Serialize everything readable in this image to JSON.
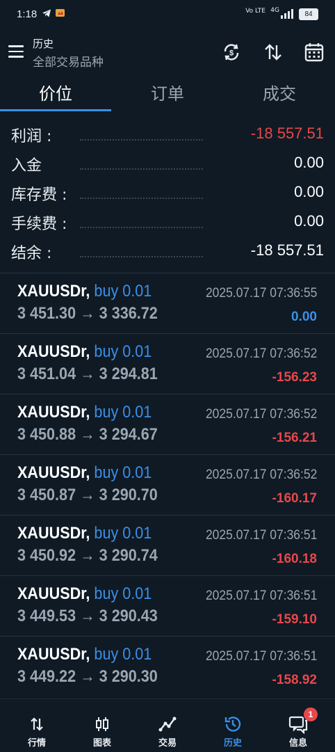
{
  "status_bar": {
    "time": "1:18",
    "battery": "84",
    "network": "4G",
    "volte": "Vo LTE"
  },
  "header": {
    "title": "历史",
    "subtitle": "全部交易品种"
  },
  "tabs": [
    {
      "label": "价位",
      "active": true
    },
    {
      "label": "订单",
      "active": false
    },
    {
      "label": "成交",
      "active": false
    }
  ],
  "summary": [
    {
      "label": "利润 :",
      "value": "-18 557.51",
      "negative": true
    },
    {
      "label": "入金",
      "value": "0.00",
      "negative": false
    },
    {
      "label": "库存费 :",
      "value": "0.00",
      "negative": false
    },
    {
      "label": "手续费 :",
      "value": "0.00",
      "negative": false
    },
    {
      "label": "结余 :",
      "value": "-18 557.51",
      "negative": false
    }
  ],
  "deals": [
    {
      "symbol": "XAUUSDr,",
      "side": "buy 0.01",
      "prices": "3 451.30 → 3 336.72",
      "time": "2025.07.17 07:36:55",
      "profit": "0.00",
      "profit_color": "#3b8fe7"
    },
    {
      "symbol": "XAUUSDr,",
      "side": "buy 0.01",
      "prices": "3 451.04 → 3 294.81",
      "time": "2025.07.17 07:36:52",
      "profit": "-156.23",
      "profit_color": "#e8484b"
    },
    {
      "symbol": "XAUUSDr,",
      "side": "buy 0.01",
      "prices": "3 450.88 → 3 294.67",
      "time": "2025.07.17 07:36:52",
      "profit": "-156.21",
      "profit_color": "#e8484b"
    },
    {
      "symbol": "XAUUSDr,",
      "side": "buy 0.01",
      "prices": "3 450.87 → 3 290.70",
      "time": "2025.07.17 07:36:52",
      "profit": "-160.17",
      "profit_color": "#e8484b"
    },
    {
      "symbol": "XAUUSDr,",
      "side": "buy 0.01",
      "prices": "3 450.92 → 3 290.74",
      "time": "2025.07.17 07:36:51",
      "profit": "-160.18",
      "profit_color": "#e8484b"
    },
    {
      "symbol": "XAUUSDr,",
      "side": "buy 0.01",
      "prices": "3 449.53 → 3 290.43",
      "time": "2025.07.17 07:36:51",
      "profit": "-159.10",
      "profit_color": "#e8484b"
    },
    {
      "symbol": "XAUUSDr,",
      "side": "buy 0.01",
      "prices": "3 449.22 → 3 290.30",
      "time": "2025.07.17 07:36:51",
      "profit": "-158.92",
      "profit_color": "#e8484b"
    }
  ],
  "bottom_nav": [
    {
      "label": "行情",
      "icon": "quotes-icon",
      "active": false
    },
    {
      "label": "图表",
      "icon": "chart-icon",
      "active": false
    },
    {
      "label": "交易",
      "icon": "trade-icon",
      "active": false
    },
    {
      "label": "历史",
      "icon": "history-icon",
      "active": true
    },
    {
      "label": "信息",
      "icon": "messages-icon",
      "active": false,
      "badge": "1"
    }
  ],
  "colors": {
    "background": "#0f1a24",
    "accent": "#3b8fe7",
    "negative": "#e8484b",
    "muted": "#9aa7b3"
  }
}
